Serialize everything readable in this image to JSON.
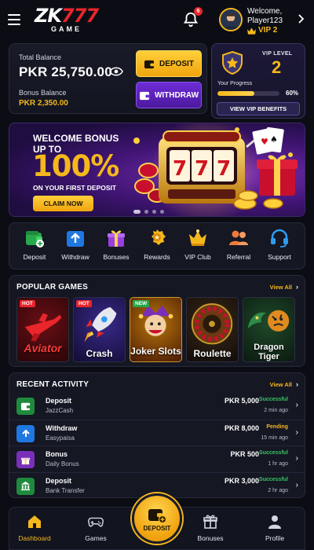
{
  "header": {
    "logo_main_prefix": "ZK",
    "logo_main_number": "777",
    "logo_sub": "GAME",
    "notification_count": "6",
    "welcome": "Welcome,",
    "username": "Player123",
    "vip_badge": "VIP 2"
  },
  "balance": {
    "total_label": "Total Balance",
    "total_value": "PKR 25,750.00",
    "bonus_label": "Bonus Balance",
    "bonus_value": "PKR 2,350.00",
    "deposit_label": "DEPOSIT",
    "withdraw_label": "WITHDRAW"
  },
  "vip": {
    "level_label": "VIP LEVEL",
    "level_value": "2",
    "progress_label": "Your Progress",
    "progress_pct": "60%",
    "progress_value": 0.6,
    "benefits_label": "VIEW VIP BENEFITS"
  },
  "banner": {
    "line1": "WELCOME BONUS",
    "line2": "UP TO",
    "percent": "100%",
    "line3": "ON YOUR FIRST DEPOSIT",
    "cta": "CLAIM NOW",
    "slot_digits": [
      "7",
      "7",
      "7"
    ],
    "slide_count": 4,
    "active_slide": 0
  },
  "quick_actions": [
    {
      "label": "Deposit",
      "icon": "wallet-plus-icon"
    },
    {
      "label": "Withdraw",
      "icon": "upload-icon"
    },
    {
      "label": "Bonuses",
      "icon": "gift-icon"
    },
    {
      "label": "Rewards",
      "icon": "medal-icon"
    },
    {
      "label": "VIP Club",
      "icon": "crown-icon"
    },
    {
      "label": "Referral",
      "icon": "users-icon"
    },
    {
      "label": "Support",
      "icon": "headset-icon"
    }
  ],
  "popular_games": {
    "title": "POPULAR GAMES",
    "view_all": "View All",
    "items": [
      {
        "name": "Aviator",
        "tag": "HOT"
      },
      {
        "name": "Crash",
        "tag": "HOT"
      },
      {
        "name": "Joker Slots",
        "tag": "NEW"
      },
      {
        "name": "Roulette",
        "tag": ""
      },
      {
        "name": "Dragon Tiger",
        "tag": ""
      }
    ]
  },
  "recent_activity": {
    "title": "RECENT ACTIVITY",
    "view_all": "View All",
    "items": [
      {
        "title": "Deposit",
        "method": "JazzCash",
        "amount": "PKR 5,000",
        "status": "Successful",
        "time": "2 min ago",
        "icon": "wallet-icon"
      },
      {
        "title": "Withdraw",
        "method": "Easypaisa",
        "amount": "PKR 8,000",
        "status": "Pending",
        "time": "15 min ago",
        "icon": "upload-icon"
      },
      {
        "title": "Bonus",
        "method": "Daily Bonus",
        "amount": "PKR 500",
        "status": "Successful",
        "time": "1 hr ago",
        "icon": "gift-icon"
      },
      {
        "title": "Deposit",
        "method": "Bank Transfer",
        "amount": "PKR 3,000",
        "status": "Successful",
        "time": "2 hr ago",
        "icon": "bank-icon"
      }
    ]
  },
  "bottom_nav": {
    "dashboard": "Dashboard",
    "games": "Games",
    "deposit": "DEPOSIT",
    "bonuses": "Bonuses",
    "profile": "Profile"
  },
  "colors": {
    "background": "#0c0d14",
    "accent_gold": "#f5b81c",
    "brand_red": "#e8262c",
    "purple": "#6d2dd6",
    "success": "#36c463",
    "pending": "#f5b81c"
  }
}
